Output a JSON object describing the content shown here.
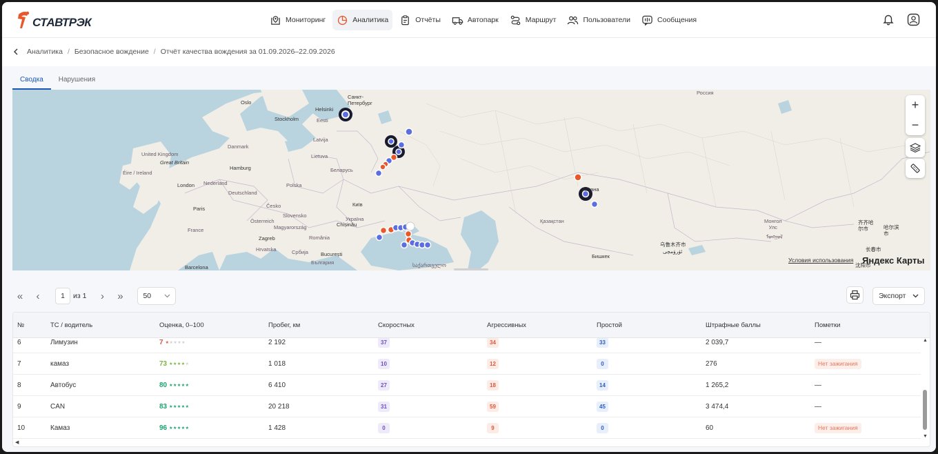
{
  "brand": {
    "name": "СТАВТРЭК"
  },
  "nav": {
    "items": [
      {
        "label": "Мониторинг",
        "icon": "map-pin-icon"
      },
      {
        "label": "Аналитика",
        "icon": "pie-chart-icon",
        "active": true
      },
      {
        "label": "Отчёты",
        "icon": "clipboard-icon"
      },
      {
        "label": "Автопарк",
        "icon": "truck-icon"
      },
      {
        "label": "Маршрут",
        "icon": "route-icon"
      },
      {
        "label": "Пользователи",
        "icon": "users-icon"
      },
      {
        "label": "Сообщения",
        "icon": "message-icon"
      }
    ]
  },
  "breadcrumb": {
    "items": [
      "Аналитика",
      "Безопасное вождение",
      "Отчёт качества вождения за 01.09.2026–22.09.2026"
    ]
  },
  "tabs": [
    {
      "label": "Сводка",
      "active": true
    },
    {
      "label": "Нарушения",
      "active": false
    }
  ],
  "map": {
    "labels": {
      "russia": "Россия",
      "helsinki": "Helsinki",
      "spb": "Санкт-\nПетербург",
      "oslo": "Oslo",
      "stockholm": "Stockholm",
      "eesti": "Eesti",
      "latvija": "Latvija",
      "danmark": "Danmark",
      "uk": "United Kingdom",
      "gb": "Great Britain",
      "eire": "Éire / Ireland",
      "lietuva": "Lietuva",
      "hamburg": "Hamburg",
      "belarus": "Беларусь",
      "london": "London",
      "nederland": "Nederland",
      "deutschland": "Deutschland",
      "polska": "Polska",
      "kyiv": "Київ",
      "paris": "Paris",
      "cesko": "Česko",
      "slovensko": "Slovensko",
      "ukraina": "Україна",
      "france": "France",
      "osterreich": "Österreich",
      "magyar": "Magyarország",
      "chisinau": "Chișinău",
      "zagreb": "Zagreb",
      "romania": "România",
      "hrvatska": "Hrvatska",
      "srbija": "Србија",
      "bucuresti": "București",
      "bulgaria": "България",
      "barcelona": "Barcelona",
      "georgia": "საქართველო",
      "kazakhstan": "Қазақстан",
      "astana": "Астана",
      "bishkek": "Бишкек",
      "mongol": "Монгол\nУлс",
      "mongol_script": "ᠮᠣᠩᠭᠣᠯ",
      "qiqihar": "齐齐哈\n尔市",
      "harbin": "哈尔滨\n市",
      "changchun": "长春市",
      "shenyang": "沈阳市",
      "urumqi": "乌鲁木齐市",
      "urumqi2": "ئۈرۈمچى"
    },
    "terms": "Условия использования",
    "brand": "Яндекс Карты",
    "zoom_in": "+",
    "zoom_out": "−"
  },
  "pager": {
    "first": "«",
    "prev": "‹",
    "page": "1",
    "of": "из 1",
    "next": "›",
    "last": "»",
    "page_size": "50"
  },
  "actions": {
    "export": "Экспорт"
  },
  "table": {
    "headers": {
      "num": "№",
      "vehicle": "ТС / водитель",
      "score": "Оценка, 0–100",
      "mileage": "Пробег, км",
      "speeding": "Скоростных",
      "aggressive": "Агрессивных",
      "idle": "Простой",
      "penalty": "Штрафные баллы",
      "notes": "Пометки"
    },
    "rows": [
      {
        "num": "6",
        "vehicle": "Лимузин",
        "score": "7",
        "stars": "★★★★★",
        "mileage": "2 192",
        "speeding": "37",
        "aggressive": "34",
        "idle": "33",
        "penalty": "2 039,7",
        "note": "—"
      },
      {
        "num": "7",
        "vehicle": "камаз",
        "score": "73",
        "stars": "★★★★★",
        "mileage": "1 018",
        "speeding": "10",
        "aggressive": "12",
        "idle": "0",
        "penalty": "276",
        "note": "Нет зажигания"
      },
      {
        "num": "8",
        "vehicle": "Автобус",
        "score": "80",
        "stars": "★★★★★",
        "mileage": "6 410",
        "speeding": "27",
        "aggressive": "18",
        "idle": "14",
        "penalty": "1 265,2",
        "note": "—"
      },
      {
        "num": "9",
        "vehicle": "CAN",
        "score": "83",
        "stars": "★★★★★",
        "mileage": "20 218",
        "speeding": "31",
        "aggressive": "59",
        "idle": "45",
        "penalty": "3 474,4",
        "note": "—"
      },
      {
        "num": "10",
        "vehicle": "Камаз",
        "score": "96",
        "stars": "★★★★★",
        "mileage": "1 428",
        "speeding": "0",
        "aggressive": "9",
        "idle": "0",
        "penalty": "60",
        "note": "Нет зажигания"
      }
    ]
  },
  "colors": {
    "accent": "#1b57b3",
    "logo": "#e8582a",
    "score_low": "#d9534f",
    "score_mid": "#7cb342",
    "score_high": "#1aa36f",
    "speed_bg": "#efeaf9",
    "speed_fg": "#6b4fc2",
    "aggr_bg": "#fdebe6",
    "aggr_fg": "#e0573a",
    "idle_bg": "#e8effc",
    "idle_fg": "#2a5fc4",
    "note_fg": "#e4775a"
  }
}
